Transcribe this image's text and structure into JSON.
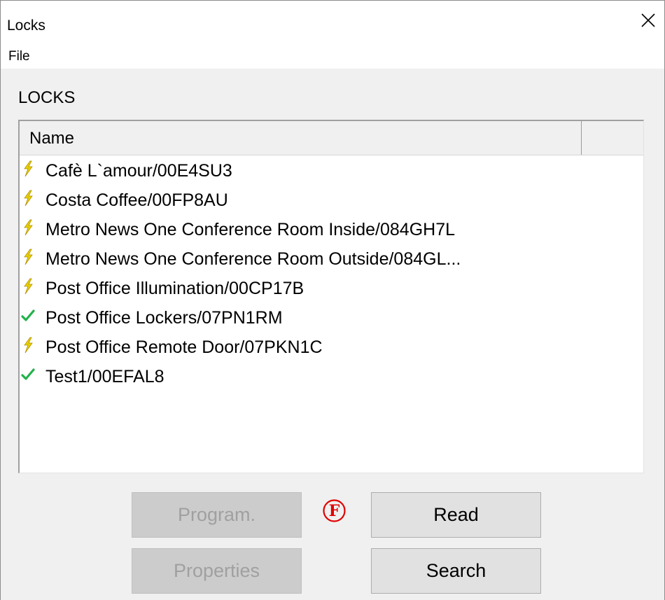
{
  "window": {
    "title": "Locks",
    "close_icon": "close-x-icon"
  },
  "menu": {
    "file_label": "File"
  },
  "section": {
    "label": "LOCKS"
  },
  "list": {
    "columns": [
      "Name",
      ""
    ],
    "items": [
      {
        "label": "Cafè L`amour/00E4SU3",
        "icon": "lightning-icon"
      },
      {
        "label": "Costa Coffee/00FP8AU",
        "icon": "lightning-icon"
      },
      {
        "label": "Metro News One Conference Room Inside/084GH7L",
        "icon": "lightning-icon"
      },
      {
        "label": "Metro News One Conference Room Outside/084GL...",
        "icon": "lightning-icon"
      },
      {
        "label": "Post Office Illumination/00CP17B",
        "icon": "lightning-icon"
      },
      {
        "label": "Post Office Lockers/07PN1RM",
        "icon": "check-icon"
      },
      {
        "label": "Post Office Remote Door/07PKN1C",
        "icon": "lightning-icon"
      },
      {
        "label": "Test1/00EFAL8",
        "icon": "check-icon"
      }
    ]
  },
  "buttons": {
    "program_label": "Program.",
    "program_enabled": false,
    "properties_label": "Properties",
    "properties_enabled": false,
    "read_label": "Read",
    "search_label": "Search"
  },
  "badge": {
    "text": "F",
    "color": "#e00000"
  },
  "colors": {
    "lightning": "#e8d000",
    "check": "#22b14c"
  }
}
